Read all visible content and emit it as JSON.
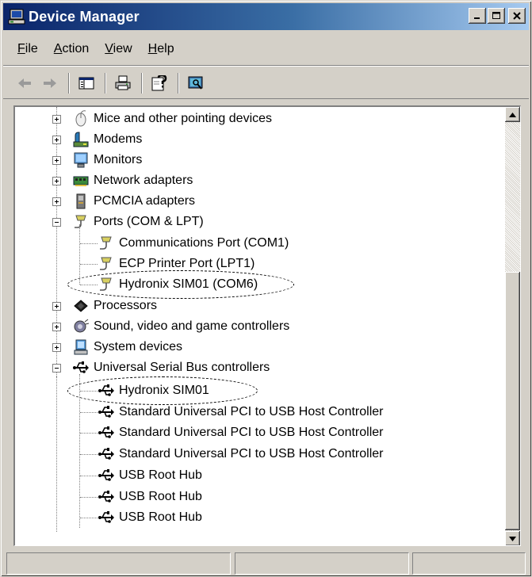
{
  "window": {
    "title": "Device Manager"
  },
  "menu": [
    {
      "label": "File",
      "mnemonic": "F",
      "rest": "ile"
    },
    {
      "label": "Action",
      "mnemonic": "A",
      "rest": "ction"
    },
    {
      "label": "View",
      "mnemonic": "V",
      "rest": "iew"
    },
    {
      "label": "Help",
      "mnemonic": "H",
      "rest": "elp"
    }
  ],
  "toolbar": [
    "back-arrow-icon",
    "forward-arrow-icon",
    "show-hide-console-tree-icon",
    "print-icon",
    "properties-help-icon",
    "scan-hardware-icon"
  ],
  "tree": {
    "items": [
      {
        "label": "Mice and other pointing devices",
        "icon": "mouse-icon"
      },
      {
        "label": "Modems",
        "icon": "modem-icon"
      },
      {
        "label": "Monitors",
        "icon": "monitor-icon"
      },
      {
        "label": "Network adapters",
        "icon": "network-adapter-icon"
      },
      {
        "label": "PCMCIA adapters",
        "icon": "pcmcia-icon"
      },
      {
        "label": "Ports (COM & LPT)",
        "icon": "port-icon"
      },
      {
        "label": "Communications Port (COM1)",
        "icon": "port-icon"
      },
      {
        "label": "ECP Printer Port (LPT1)",
        "icon": "port-icon"
      },
      {
        "label": "Hydronix SIM01 (COM6)",
        "icon": "port-icon"
      },
      {
        "label": "Processors",
        "icon": "processor-icon"
      },
      {
        "label": "Sound, video and game controllers",
        "icon": "sound-icon"
      },
      {
        "label": "System devices",
        "icon": "system-devices-icon"
      },
      {
        "label": "Universal Serial Bus controllers",
        "icon": "usb-icon"
      },
      {
        "label": "Hydronix SIM01",
        "icon": "usb-icon"
      },
      {
        "label": "Standard Universal PCI to USB Host Controller",
        "icon": "usb-icon"
      },
      {
        "label": "Standard Universal PCI to USB Host Controller",
        "icon": "usb-icon"
      },
      {
        "label": "Standard Universal PCI to USB Host Controller",
        "icon": "usb-icon"
      },
      {
        "label": "USB Root Hub",
        "icon": "usb-icon"
      },
      {
        "label": "USB Root Hub",
        "icon": "usb-icon"
      },
      {
        "label": "USB Root Hub",
        "icon": "usb-icon"
      }
    ]
  },
  "colors": {
    "titlebar_start": "#0a246a",
    "titlebar_end": "#a6caf0",
    "face": "#d4d0c8"
  }
}
